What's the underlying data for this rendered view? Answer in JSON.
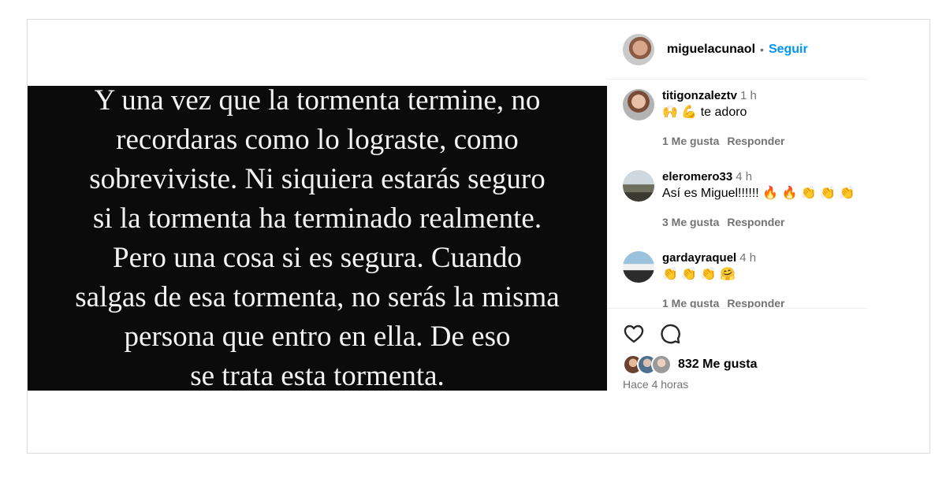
{
  "post": {
    "image_text": "Y una vez que la tormenta termine, no\nrecordaras como lo lograste, como\nsobreviviste. Ni siquiera estarás seguro\nsi la tormenta ha terminado realmente.\nPero una cosa si es segura. Cuando\nsalgas de esa tormenta, no serás la misma\npersona que entro en ella. De eso\nse trata esta tormenta."
  },
  "header": {
    "username": "miguelacunaol",
    "separator": "•",
    "follow_label": "Seguir"
  },
  "comments": [
    {
      "user": "titigonzaleztv",
      "time": "1 h",
      "text": "🙌 💪  te adoro",
      "likes": "1 Me gusta",
      "reply": "Responder"
    },
    {
      "user": "eleromero33",
      "time": "4 h",
      "text": "Así es Miguel!!!!!! 🔥 🔥 👏 👏 👏",
      "likes": "3 Me gusta",
      "reply": "Responder"
    },
    {
      "user": "gardayraquel",
      "time": "4 h",
      "text": "👏 👏 👏 🤗",
      "likes": "1 Me gusta",
      "reply": "Responder"
    }
  ],
  "footer": {
    "likes_count": "832 Me gusta",
    "time_ago": "Hace 4 horas"
  },
  "icons": {
    "like": "heart-icon",
    "comment": "comment-icon"
  }
}
